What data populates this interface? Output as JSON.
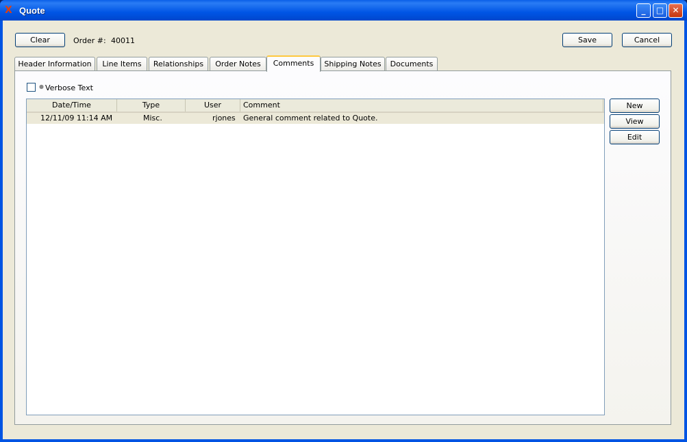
{
  "window": {
    "title": "Quote",
    "minimize": "_",
    "maximize": "□",
    "close": "✕"
  },
  "toolbar": {
    "clear": "Clear",
    "order_label": "Order #:",
    "order_value": "40011",
    "save": "Save",
    "cancel": "Cancel"
  },
  "tabs": [
    "Header Information",
    "Line Items",
    "Relationships",
    "Order Notes",
    "Comments",
    "Shipping Notes",
    "Documents"
  ],
  "active_tab": "Comments",
  "verbose": {
    "label": "Verbose Text",
    "checked": false
  },
  "table": {
    "columns": [
      "Date/Time",
      "Type",
      "User",
      "Comment"
    ],
    "rows": [
      {
        "datetime": "12/11/09 11:14 AM",
        "type": "Misc.",
        "user": "rjones",
        "comment": "General comment related to Quote."
      }
    ]
  },
  "side_buttons": {
    "new": "New",
    "view": "View",
    "edit": "Edit"
  }
}
